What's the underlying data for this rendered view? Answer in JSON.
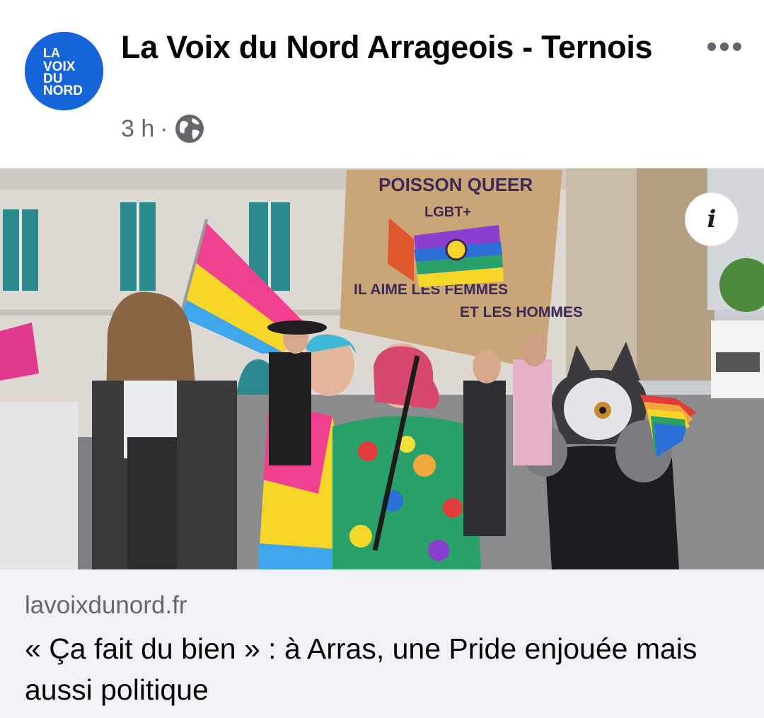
{
  "post": {
    "page_name": "La Voix du Nord Arrageois - Ternois",
    "time": "3 h",
    "separator": "·",
    "privacy_icon": "globe-icon",
    "more_icon": "more-dots-icon"
  },
  "avatar": {
    "logo_lines": [
      "LA",
      "VOIX",
      "DU",
      "NORD"
    ],
    "color": "#1565d8"
  },
  "photo": {
    "sign_lines": [
      "POISSON QUEER",
      "LGBT+",
      "IL AIME LES FEMMES",
      "ET LES HOMMES"
    ],
    "info_icon": "info-icon",
    "info_label": "i"
  },
  "link": {
    "domain": "lavoixdunord.fr",
    "title": "« Ça fait du bien » : à Arras, une Pride enjouée mais aussi politique"
  },
  "colors": {
    "text_primary": "#050505",
    "text_secondary": "#65676b",
    "preview_bg": "#f0f2f5"
  }
}
